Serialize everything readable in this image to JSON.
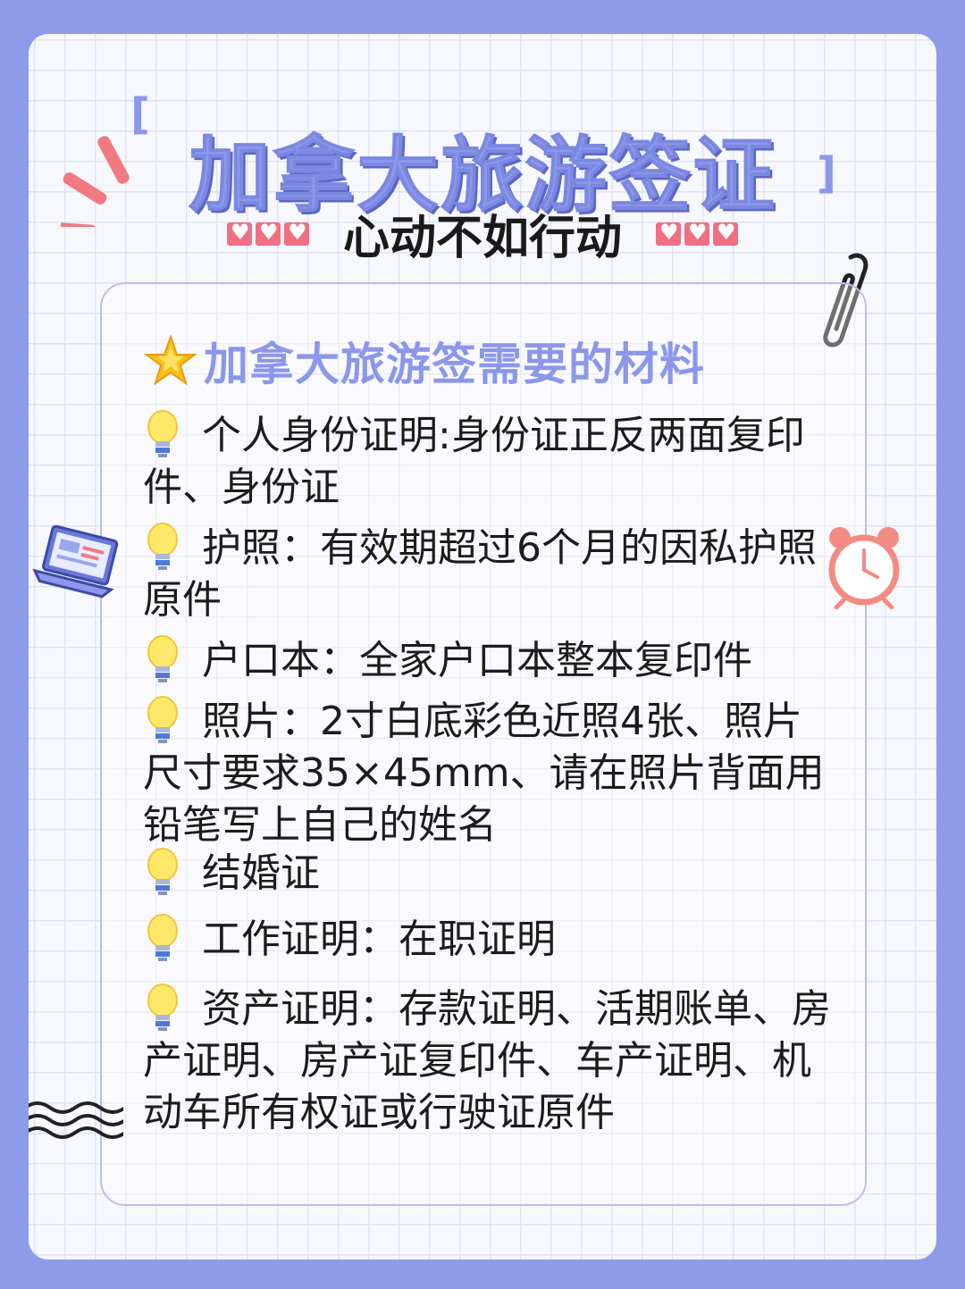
{
  "header": {
    "title": "加拿大旅游签证",
    "bracket_left": "[",
    "bracket_right": "]",
    "subtitle": "心动不如行动"
  },
  "card": {
    "heading": "加拿大旅游签需要的材料",
    "items": [
      {
        "text": "个人身份证明:身份证正反两面复印件、身份证"
      },
      {
        "text": "护照：有效期超过6个月的因私护照原件"
      },
      {
        "text": "户口本：全家户口本整本复印件"
      },
      {
        "text": "照片：2寸白底彩色近照4张、照片尺寸要求35×45mm、请在照片背面用铅笔写上自己的姓名"
      },
      {
        "text": "结婚证"
      },
      {
        "text": "工作证明：在职证明"
      },
      {
        "text": "资产证明：存款证明、活期账单、房产证明、房产证复印件、车产证明、机动车所有权证或行驶证原件"
      }
    ]
  },
  "icons": {
    "heading_icon": "star-icon",
    "item_icon": "lightbulb-icon",
    "decor": [
      "burst-lines-icon",
      "heart-icon",
      "paperclip-icon",
      "laptop-icon",
      "alarm-clock-icon",
      "wave-lines-icon"
    ]
  },
  "colors": {
    "background": "#8e9be8",
    "title": "#8b97ea",
    "heart": "#f06f83",
    "text": "#1c1c1c"
  }
}
